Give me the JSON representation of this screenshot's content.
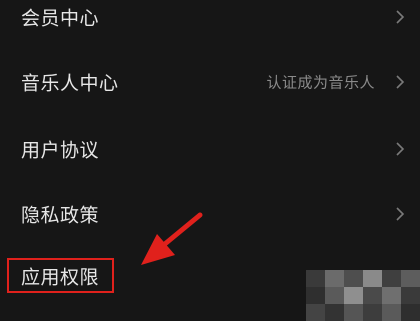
{
  "settings": {
    "items": [
      {
        "label": "会员中心",
        "value": ""
      },
      {
        "label": "音乐人中心",
        "value": "认证成为音乐人"
      },
      {
        "label": "用户协议",
        "value": ""
      },
      {
        "label": "隐私政策",
        "value": ""
      },
      {
        "label": "应用权限",
        "value": ""
      }
    ]
  },
  "annotation": {
    "color": "#e0211c"
  },
  "theme": {
    "background": "#161616",
    "text": "#e6e6e6",
    "secondary": "#8a8a8a",
    "chevron": "#7a7a7a"
  }
}
